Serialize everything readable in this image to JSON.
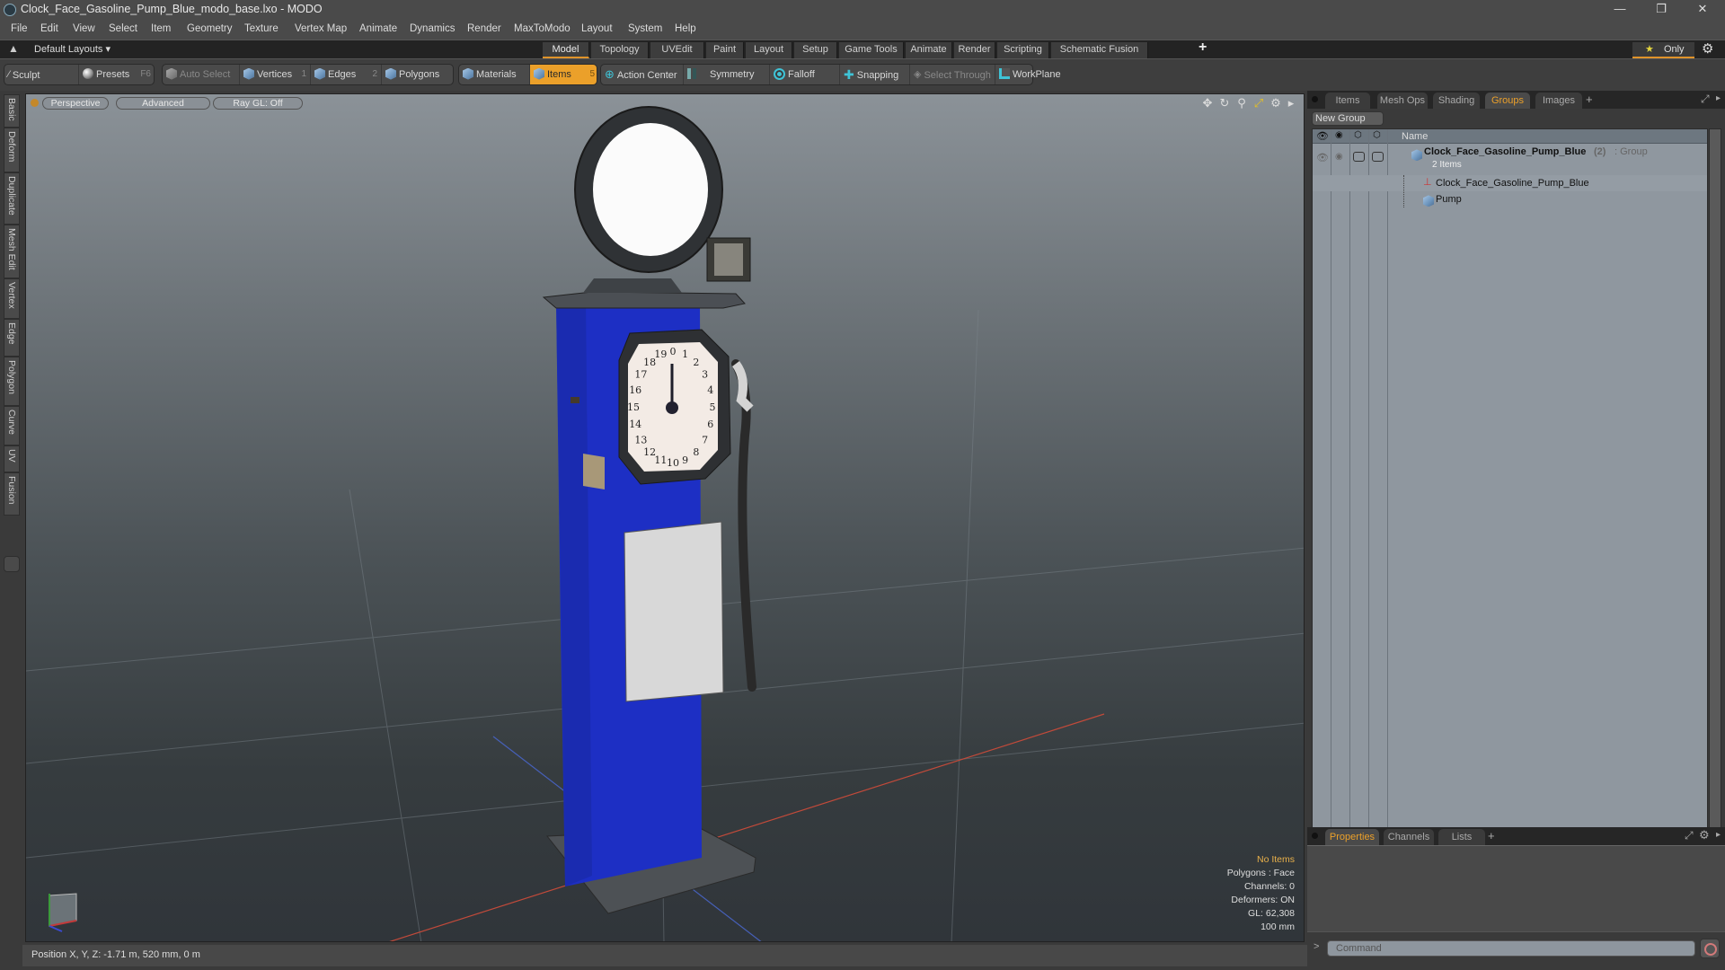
{
  "window": {
    "title": "Clock_Face_Gasoline_Pump_Blue_modo_base.lxo - MODO",
    "controls": [
      "minimize",
      "restore",
      "close"
    ]
  },
  "menubar": {
    "items": [
      "File",
      "Edit",
      "View",
      "Select",
      "Item",
      "Geometry",
      "Texture",
      "Vertex Map",
      "Animate",
      "Dynamics",
      "Render",
      "MaxToModo",
      "Layout",
      "System",
      "Help"
    ]
  },
  "layoutbar": {
    "layouts_label": "Default Layouts",
    "tabs": [
      "Model",
      "Topology",
      "UVEdit",
      "Paint",
      "Layout",
      "Setup",
      "Game Tools",
      "Animate",
      "Render",
      "Scripting",
      "Schematic Fusion"
    ],
    "active_tab": "Model",
    "add_label": "+",
    "only_label": "Only"
  },
  "toolbar": {
    "sculpt": "Sculpt",
    "presets": "Presets",
    "presets_key": "F6",
    "auto_select": "Auto Select",
    "vertices": "Vertices",
    "vertices_key": "1",
    "edges": "Edges",
    "edges_key": "2",
    "polygons": "Polygons",
    "materials": "Materials",
    "items": "Items",
    "items_key": "5",
    "action_center": "Action Center",
    "symmetry": "Symmetry",
    "falloff": "Falloff",
    "snapping": "Snapping",
    "select_through": "Select Through",
    "workplane": "WorkPlane",
    "active_mode": "Items",
    "accent_color": "#eba02a"
  },
  "left_tabs": [
    "Basic",
    "Deform",
    "Duplicate",
    "Mesh Edit",
    "Vertex",
    "Edge",
    "Polygon",
    "Curve",
    "UV",
    "Fusion"
  ],
  "viewport": {
    "view_mode": "Perspective",
    "shading": "Advanced",
    "raygl": "Ray GL: Off",
    "icons": [
      "move-view-icon",
      "rotate-view-icon",
      "zoom-view-icon",
      "fit-view-icon",
      "settings-icon",
      "expand-arrow-icon"
    ],
    "stats": {
      "selection": "No Items",
      "polygons": "Polygons : Face",
      "channels": "Channels: 0",
      "deformers": "Deformers: ON",
      "gl": "GL: 62,308",
      "grid": "100 mm"
    },
    "model": {
      "body_color": "#1d2fc4",
      "dial_numbers": [
        "0",
        "1",
        "2",
        "3",
        "4",
        "5",
        "6",
        "7",
        "8",
        "9",
        "10",
        "11",
        "12",
        "13",
        "14",
        "15",
        "16",
        "17",
        "18",
        "19"
      ]
    }
  },
  "statusbar": {
    "position": "Position X, Y, Z:   -1.71 m, 520 mm, 0 m"
  },
  "right_panel": {
    "top_tabs": [
      "Items",
      "Mesh Ops",
      "Shading",
      "Groups",
      "Images"
    ],
    "active_top_tab": "Groups",
    "new_group_label": "New Group",
    "column_name": "Name",
    "groups": [
      {
        "name": "Clock_Face_Gasoline_Pump_Blue",
        "count": "(2)",
        "type": ": Group",
        "subtitle": "2 Items",
        "children": [
          {
            "name": "Clock_Face_Gasoline_Pump_Blue",
            "icon": "locator-icon"
          },
          {
            "name": "Pump",
            "icon": "mesh-icon"
          }
        ]
      }
    ],
    "bottom_tabs": [
      "Properties",
      "Channels",
      "Lists"
    ],
    "active_bottom_tab": "Properties",
    "command_placeholder": "Command"
  }
}
